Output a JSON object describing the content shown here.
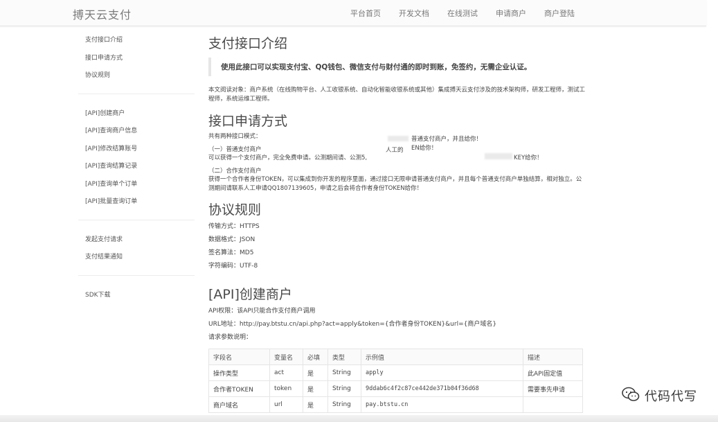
{
  "brand": "搏天云支付",
  "nav": [
    "平台首页",
    "开发文档",
    "在线测试",
    "申请商户",
    "商户登陆"
  ],
  "sidebar": {
    "group1": [
      "支付接口介绍",
      "接口申请方式",
      "协议规则"
    ],
    "group2": [
      "[API]创建商户",
      "[API]查询商户信息",
      "[API]修改结算账号",
      "[API]查询结算记录",
      "[API]查询单个订单",
      "[API]批量查询订单"
    ],
    "group3": [
      "发起支付请求",
      "支付结果通知"
    ],
    "group4": [
      "SDK下载"
    ]
  },
  "intro": {
    "title": "支付接口介绍",
    "quote": "使用此接口可以实现支付宝、QQ钱包、微信支付与财付通的即时到账，免签约，无需企业认证。",
    "readers": "本文阅读对象：商户系统（在线购物平台、人工收银系统、自动化智能收银系统或其他）集成搏天云支付涉及的技术架构师，研发工程师，测试工程师，系统运维工程师。"
  },
  "apply": {
    "title": "接口申请方式",
    "lead": "共有两种接口模式：",
    "mode1_title": "（一）普通支付商户",
    "mode1_desc": "可以获得一个支付商户，完全免费申请。公测期间请、公测5,",
    "frag1": "普通支付商户，并且给你！",
    "frag2": "人工的",
    "frag3": "EN给你！",
    "frag4": "KEY给你！",
    "mode2_title": "（二）合作支付商户",
    "mode2_desc": "获得一个合作者身份TOKEN，可以集成到你开发的程序里面，通过接口无限申请普通支付商户，并且每个普通支付商户单独结算，相对独立。公测期间请联系人工申请QQ1807139605，申请之后会将合作者身份TOKEN给你！"
  },
  "protocol": {
    "title": "协议规则",
    "rows": [
      {
        "k": "传输方式：",
        "v": "HTTPS"
      },
      {
        "k": "数据格式：",
        "v": "JSON"
      },
      {
        "k": "签名算法：",
        "v": "MD5"
      },
      {
        "k": "字符编码：",
        "v": "UTF-8"
      }
    ]
  },
  "create": {
    "title": "[API]创建商户",
    "perm": "API权限：该API只能合作支付商户调用",
    "url_label": "URL地址：",
    "url": "http://pay.btstu.cn/api.php?act=apply&token={合作者身份TOKEN}&url={商户域名}",
    "params_label": "请求参数说明：",
    "headers": [
      "字段名",
      "变量名",
      "必填",
      "类型",
      "示例值",
      "描述"
    ],
    "rows": [
      [
        "操作类型",
        "act",
        "是",
        "String",
        "apply",
        "此API固定值"
      ],
      [
        "合作者TOKEN",
        "token",
        "是",
        "String",
        "9ddab6c4f2c87ce442de371b04f36d68",
        "需要事先申请"
      ],
      [
        "商户域名",
        "url",
        "是",
        "String",
        "pay.btstu.cn",
        ""
      ]
    ]
  },
  "watermark": "代码代写",
  "colors": {
    "accent": "#4a4a4a",
    "border": "#e5e5e5",
    "nav_bg": "#fbfbfb"
  }
}
